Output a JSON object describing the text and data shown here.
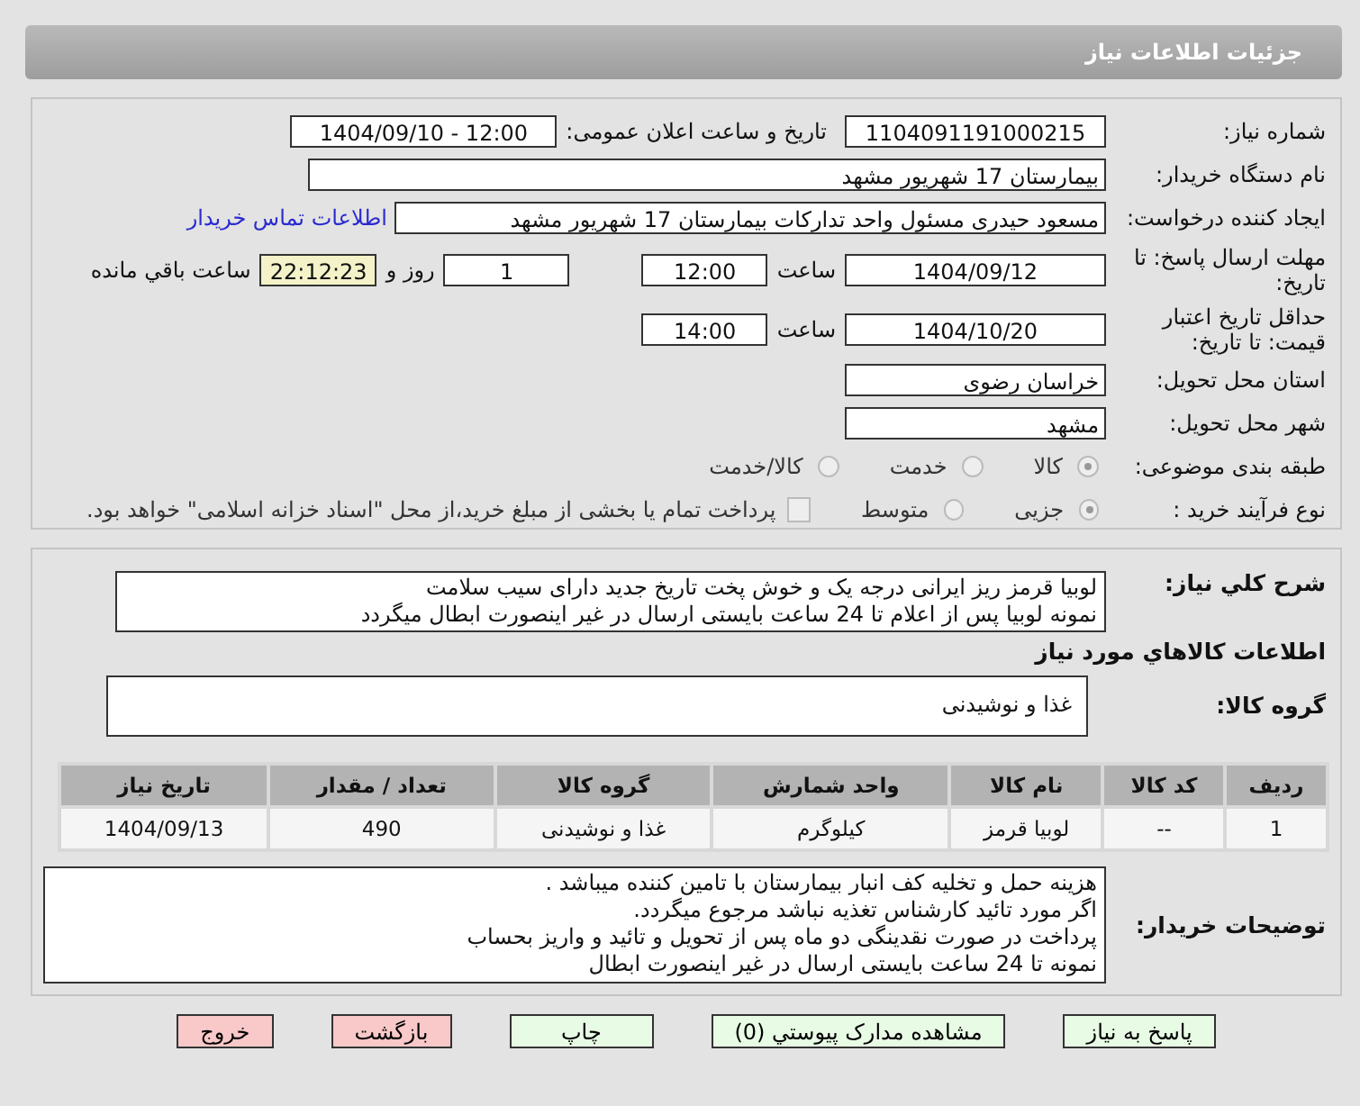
{
  "header": {
    "title": "جزئیات اطلاعات نیاز"
  },
  "fields": {
    "need_number": {
      "label": "شماره نیاز:",
      "value": "1104091191000215"
    },
    "announce": {
      "label": "تاریخ و ساعت اعلان عمومی:",
      "value": "1404/09/10 - 12:00"
    },
    "buyer": {
      "label": "نام دستگاه خریدار:",
      "value": "بیمارستان 17 شهریور مشهد"
    },
    "creator": {
      "label": "ایجاد کننده درخواست:",
      "value": "مسعود حیدری مسئول واحد تدارکات  بیمارستان 17 شهریور مشهد",
      "link": "اطلاعات تماس خریدار"
    },
    "deadline": {
      "label": "مهلت ارسال پاسخ: تا تاریخ:",
      "date": "1404/09/12",
      "time_label": "ساعت",
      "time": "12:00",
      "days": "1",
      "days_label": "روز و",
      "remaining": "22:12:23",
      "remaining_label": "ساعت باقي مانده"
    },
    "validity": {
      "label": "حداقل تاریخ اعتبار قیمت: تا تاریخ:",
      "date": "1404/10/20",
      "time_label": "ساعت",
      "time": "14:00"
    },
    "province": {
      "label": "استان محل تحویل:",
      "value": "خراسان رضوی"
    },
    "city": {
      "label": "شهر محل تحویل:",
      "value": "مشهد"
    }
  },
  "category": {
    "label": "طبقه بندی موضوعی:",
    "options": [
      {
        "label": "کالا",
        "selected": true
      },
      {
        "label": "خدمت",
        "selected": false
      },
      {
        "label": "کالا/خدمت",
        "selected": false
      }
    ]
  },
  "process": {
    "label": "نوع فرآیند خرید :",
    "options": [
      {
        "label": "جزیی",
        "selected": true
      },
      {
        "label": "متوسط",
        "selected": false
      }
    ],
    "treasury": {
      "label": "پرداخت تمام یا بخشی از مبلغ خرید،از محل \"اسناد خزانه اسلامی\" خواهد بود.",
      "checked": false
    }
  },
  "description": {
    "label": "شرح کلي نیاز:",
    "lines": [
      "لوبیا قرمز ریز ایرانی درجه یک و خوش پخت تاریخ جدید دارای سیب سلامت",
      "نمونه لوبیا پس از اعلام تا 24 ساعت بایستی ارسال در غیر اینصورت ابطال میگردد"
    ]
  },
  "goods_heading": "اطلاعات کالاهاي مورد نیاز",
  "goods_group": {
    "label": "گروه کالا:",
    "value": "غذا و نوشیدنی"
  },
  "table": {
    "columns": [
      "ردیف",
      "کد کالا",
      "نام کالا",
      "واحد شمارش",
      "گروه کالا",
      "تعداد / مقدار",
      "تاریخ نیاز"
    ],
    "rows": [
      [
        "1",
        "--",
        "لوبیا قرمز",
        "کیلوگرم",
        "غذا و نوشیدنی",
        "490",
        "1404/09/13"
      ]
    ]
  },
  "buyer_notes": {
    "label": "توضیحات خریدار:",
    "lines": [
      "هزینه حمل و تخلیه کف انبار بیمارستان با تامین کننده میباشد .",
      "اگر  مورد تائید کارشناس تغذیه نباشد مرجوع میگردد.",
      "پرداخت در صورت نقدینگی دو ماه پس از تحویل و تائید و واریز بحساب",
      "نمونه تا 24 ساعت بایستی ارسال در غیر اینصورت ابطال"
    ]
  },
  "buttons": [
    {
      "label": "پاسخ به نیاز",
      "kind": "normal"
    },
    {
      "label": "مشاهده مدارک پیوستي (0)",
      "kind": "normal"
    },
    {
      "label": "چاپ",
      "kind": "normal"
    },
    {
      "label": "بازگشت",
      "kind": "danger"
    },
    {
      "label": "خروج",
      "kind": "danger"
    }
  ]
}
